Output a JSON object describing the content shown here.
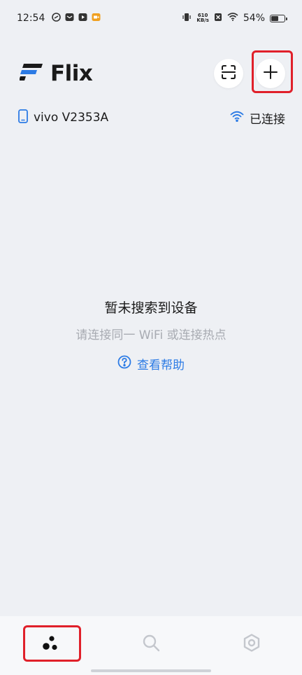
{
  "status_bar": {
    "time": "12:54",
    "net_speed_value": "610",
    "net_speed_unit": "KB/s",
    "battery_percent": "54%",
    "battery_level": 0.54
  },
  "header": {
    "app_name": "Flix",
    "brand_color": "#2c7be5"
  },
  "device": {
    "name": "vivo V2353A",
    "connection_status": "已连接"
  },
  "empty_state": {
    "title": "暂未搜索到设备",
    "subtitle": "请连接同一 WiFi 或连接热点",
    "help_link": "查看帮助"
  },
  "bottom_nav": {
    "items": [
      {
        "icon": "devices-icon",
        "active": true
      },
      {
        "icon": "search-icon",
        "active": false
      },
      {
        "icon": "settings-icon",
        "active": false
      }
    ]
  },
  "colors": {
    "accent": "#2c7be5",
    "highlight": "#e0202a",
    "background": "#eef0f4"
  }
}
